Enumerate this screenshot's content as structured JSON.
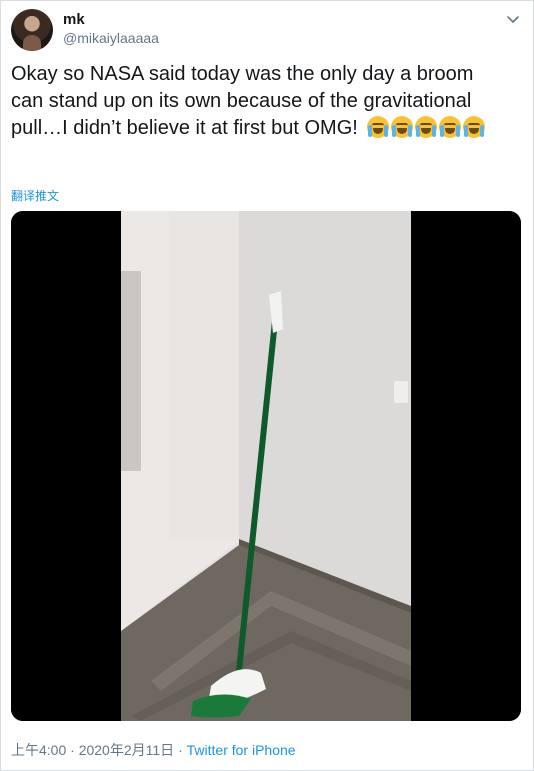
{
  "user": {
    "name": "mk",
    "handle": "@mikaiylaaaaa",
    "avatar_icon": "profile-photo"
  },
  "tweet": {
    "text": "Okay so NASA said today was the only day a broom can stand up on its own because of the gravitational pull…I didn’t believe it at first but OMG!",
    "emoji_icon": "loudly-crying-face-emoji",
    "emoji_count": 5,
    "translate_label": "翻译推文"
  },
  "media": {
    "type": "video-frame",
    "subject": "broom-standing-icon"
  },
  "meta": {
    "time": "上午4:00",
    "separator": "·",
    "date": "2020年2月11日",
    "source": "Twitter for iPhone"
  },
  "icons": {
    "menu": "chevron-down-icon"
  },
  "colors": {
    "link": "#1b95e0",
    "secondary_text": "#657786",
    "broom_handle": "#0f5a2b"
  }
}
